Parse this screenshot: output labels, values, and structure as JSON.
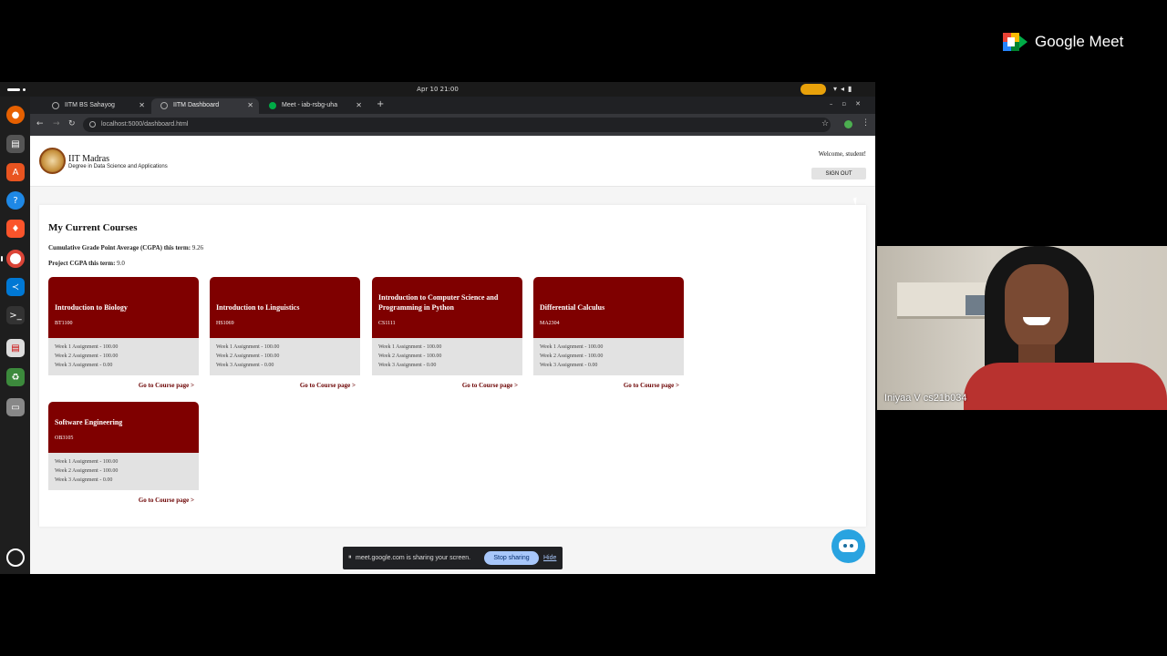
{
  "system": {
    "clock": "Apr 10  21:00"
  },
  "browser": {
    "tabs": [
      {
        "label": "IITM BS Sahayog",
        "active": false
      },
      {
        "label": "IITM Dashboard",
        "active": true
      },
      {
        "label": "Meet - iab-rsbg-uha",
        "active": false
      }
    ],
    "url": "localhost:5000/dashboard.html"
  },
  "site": {
    "brand_title": "IIT Madras",
    "brand_subtitle": "Degree in Data Science and Applications",
    "welcome": "Welcome, student!",
    "signout_label": "SIGN OUT"
  },
  "dashboard": {
    "title": "My Current Courses",
    "cgpa_label": "Cumulative Grade Point Average (CGPA) this term:",
    "cgpa_value": "9.26",
    "project_cgpa_label": "Project CGPA this term:",
    "project_cgpa_value": "9.0",
    "link_label": "Go to Course page >",
    "courses": [
      {
        "name": "Introduction to Biology",
        "code": "BT1100",
        "assignments": [
          "Week 1 Assignment - 100.00",
          "Week 2 Assignment - 100.00",
          "Week 3 Assignment - 0.00"
        ]
      },
      {
        "name": "Introduction to Linguistics",
        "code": "HS1069",
        "assignments": [
          "Week 1 Assignment - 100.00",
          "Week 2 Assignment - 100.00",
          "Week 3 Assignment - 0.00"
        ]
      },
      {
        "name": "Introduction to Computer Science and Programming in Python",
        "code": "CS1111",
        "assignments": [
          "Week 1 Assignment - 100.00",
          "Week 2 Assignment - 100.00",
          "Week 3 Assignment - 0.00"
        ]
      },
      {
        "name": "Differential Calculus",
        "code": "MA2304",
        "assignments": [
          "Week 1 Assignment - 100.00",
          "Week 2 Assignment - 100.00",
          "Week 3 Assignment - 0.00"
        ]
      },
      {
        "name": "Software Engineering",
        "code": "OB3105",
        "assignments": [
          "Week 1 Assignment - 100.00",
          "Week 2 Assignment - 100.00",
          "Week 3 Assignment - 0.00"
        ]
      }
    ]
  },
  "share_bar": {
    "message": "meet.google.com is sharing your screen.",
    "stop_label": "Stop sharing",
    "hide_label": "Hide"
  },
  "meet": {
    "wordmark": "Google Meet",
    "participant_name": "Iniyaa V cs21b034"
  },
  "colors": {
    "card_header": "#7f0000",
    "card_body": "#e2e2e2",
    "link": "#6b0000",
    "stop_button": "#a8c7fa"
  },
  "icons": [
    "firefox-icon",
    "files-icon",
    "app-center-icon",
    "help-icon",
    "brave-icon",
    "chrome-icon",
    "vscode-icon",
    "terminal-icon",
    "doc-icon",
    "trash-icon",
    "drive-icon",
    "show-apps-icon",
    "chatbot-icon"
  ]
}
